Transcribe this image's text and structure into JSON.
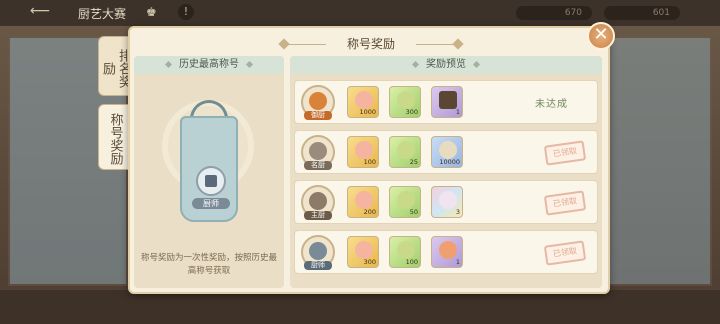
{
  "background": {
    "title": "厨艺大赛",
    "currency1": "670",
    "currency2": "601"
  },
  "modal": {
    "title": "称号奖励",
    "close_symbol": "✕"
  },
  "side_tabs": [
    {
      "label": "排名奖励",
      "active": false
    },
    {
      "label": "称号奖励",
      "active": true
    }
  ],
  "left_panel": {
    "header": "历史最高称号",
    "title_badge": "厨师",
    "note": "称号奖励为一次性奖励，按照历史最高称号获取"
  },
  "right_panel": {
    "header": "奖励预览",
    "rows": [
      {
        "title": "御厨",
        "badge_color": "#d9823a",
        "items": [
          {
            "icon": "peach-icon",
            "count": "1000",
            "frame": "gold"
          },
          {
            "icon": "jade-coin-icon",
            "count": "300",
            "frame": "green"
          },
          {
            "icon": "treasure-chest-icon",
            "count": "1",
            "frame": "purple"
          }
        ],
        "status": "未达成"
      },
      {
        "title": "名厨",
        "badge_color": "#9a8c7c",
        "items": [
          {
            "icon": "peach-icon",
            "count": "100",
            "frame": "gold"
          },
          {
            "icon": "jade-coin-icon",
            "count": "25",
            "frame": "green"
          },
          {
            "icon": "dumpling-icon",
            "count": "10000",
            "frame": "blue"
          }
        ],
        "status": "已领取"
      },
      {
        "title": "主厨",
        "badge_color": "#8d7b6a",
        "items": [
          {
            "icon": "peach-icon",
            "count": "200",
            "frame": "gold"
          },
          {
            "icon": "jade-coin-icon",
            "count": "50",
            "frame": "green"
          },
          {
            "icon": "bun-icon",
            "count": "3",
            "frame": "rainbow"
          }
        ],
        "status": "已领取"
      },
      {
        "title": "厨师",
        "badge_color": "#7a8a96",
        "items": [
          {
            "icon": "peach-icon",
            "count": "300",
            "frame": "gold"
          },
          {
            "icon": "jade-coin-icon",
            "count": "100",
            "frame": "green"
          },
          {
            "icon": "shrimp-icon",
            "count": "1",
            "frame": "purple"
          }
        ],
        "status": "已领取"
      }
    ]
  },
  "colors": {
    "accent": "#e9b84a",
    "header_green": "#d6e3d6",
    "panel_bg": "#eadfc6",
    "close_btn": "#c9834a"
  }
}
